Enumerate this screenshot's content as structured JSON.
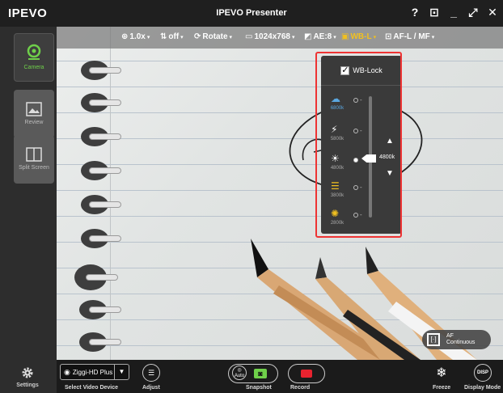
{
  "app": {
    "logo": "IPEVO",
    "title": "IPEVO Presenter"
  },
  "window_controls": [
    "?",
    "⊡",
    "_",
    "⤢",
    "✕"
  ],
  "sidebar": {
    "items": [
      {
        "label": "Camera",
        "icon": "camera-pin-icon",
        "active": true
      },
      {
        "label": "Review",
        "icon": "image-icon",
        "active": false
      },
      {
        "label": "Split Screen",
        "icon": "split-screen-icon",
        "active": false
      }
    ],
    "settings_label": "Settings"
  },
  "toolbar": {
    "zoom": "1.0x",
    "flip": "off",
    "rotate": "Rotate",
    "resolution": "1024x768",
    "ae": "AE:8",
    "wb": "WB-L",
    "af": "AF-L / MF"
  },
  "wb_panel": {
    "lock_label": "WB-Lock",
    "lock_checked": true,
    "presets": [
      {
        "kelvin": "6800k",
        "icon": "cloud-icon",
        "glyph": "☁",
        "color": "#5aa7e0"
      },
      {
        "kelvin": "5800k",
        "icon": "flash-icon",
        "glyph": "⚡",
        "color": "#ffffff"
      },
      {
        "kelvin": "4800k",
        "icon": "sun-icon",
        "glyph": "☀",
        "color": "#ffffff",
        "selected": true
      },
      {
        "kelvin": "3800k",
        "icon": "fluorescent-icon",
        "glyph": "☰",
        "color": "#f0c020"
      },
      {
        "kelvin": "2800k",
        "icon": "bulb-icon",
        "glyph": "✺",
        "color": "#f0c020"
      }
    ],
    "slider_value": "4800k"
  },
  "af_toggle": {
    "box": "[·]",
    "line1": "AF",
    "line2": "Continuous"
  },
  "bottom": {
    "device": "Ziggi-HD Plus",
    "select_label": "Select Video Device",
    "adjust_label": "Adjust",
    "auto_label": "Auto",
    "snapshot_label": "Snapshot",
    "record_label": "Record",
    "freeze_label": "Freeze",
    "display_mode_label": "Display Mode",
    "disp_label": "DISP"
  },
  "colors": {
    "accent_green": "#6fd04a",
    "record_red": "#e8232f",
    "highlight_red": "#e33333"
  }
}
